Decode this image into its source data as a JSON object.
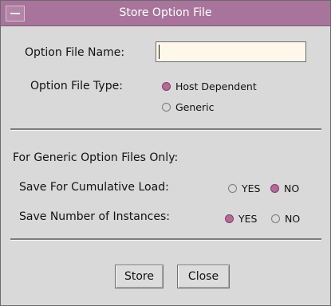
{
  "window": {
    "title": "Store Option File"
  },
  "fields": {
    "option_file_name_label": "Option File Name:",
    "option_file_name_value": ""
  },
  "option_file_type": {
    "label": "Option File Type:",
    "options": [
      {
        "label": "Host Dependent",
        "selected": true
      },
      {
        "label": "Generic",
        "selected": false
      }
    ]
  },
  "generic_section": {
    "heading": "For Generic Option Files Only:",
    "cumulative_load": {
      "label": "Save For Cumulative Load:",
      "options": [
        {
          "label": "YES",
          "selected": false
        },
        {
          "label": "NO",
          "selected": true
        }
      ]
    },
    "number_of_instances": {
      "label": "Save Number of Instances:",
      "options": [
        {
          "label": "YES",
          "selected": true
        },
        {
          "label": "NO",
          "selected": false
        }
      ]
    }
  },
  "buttons": {
    "store": "Store",
    "close": "Close"
  },
  "colors": {
    "titlebar": "#a8749b",
    "selected_radio": "#b46a98",
    "input_background": "#fff8ea",
    "dialog_background": "#d9d9d9"
  }
}
